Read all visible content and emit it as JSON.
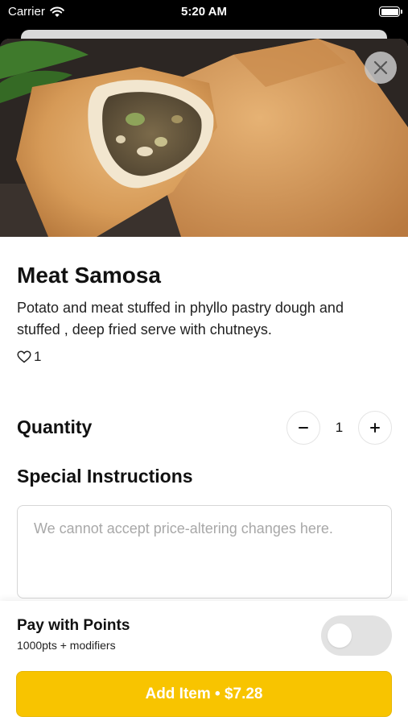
{
  "status_bar": {
    "carrier": "Carrier",
    "time": "5:20 AM",
    "wifi_icon": "wifi-icon",
    "battery_icon": "battery-icon"
  },
  "item": {
    "title": "Meat Samosa",
    "description": "Potato and meat stuffed in phyllo pastry dough and stuffed , deep fried serve with chutneys.",
    "likes": "1",
    "like_icon": "heart-outline-icon",
    "image_icon": "samosa-photo"
  },
  "quantity": {
    "label": "Quantity",
    "value": "1",
    "minus": "−",
    "plus": "+"
  },
  "instructions": {
    "label": "Special Instructions",
    "placeholder": "We cannot accept price-altering changes here.",
    "value": ""
  },
  "points": {
    "title": "Pay with Points",
    "subtitle": "1000pts + modifiers",
    "enabled": false
  },
  "add_button": {
    "label": "Add Item • $7.28"
  },
  "colors": {
    "accent": "#f8c400",
    "toggle_off": "#e2e2e2",
    "close_bg": "#c8c8c8"
  }
}
